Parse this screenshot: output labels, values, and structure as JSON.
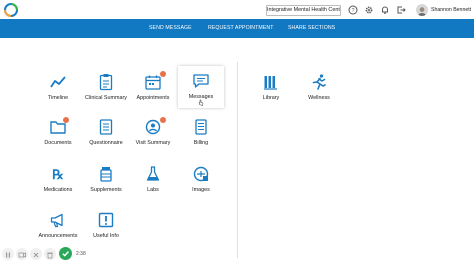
{
  "header": {
    "clinic_name": "Integrative Mental Health Center",
    "user_name": "Shannon Bennett"
  },
  "nav": {
    "send_message": "SEND MESSAGE",
    "request_appointment": "REQUEST APPOINTMENT",
    "share_sections": "SHARE SECTIONS"
  },
  "tiles": {
    "timeline": "Timeline",
    "clinical_summary": "Clinical Summary",
    "appointments": "Appointments",
    "messages": "Messages",
    "library": "Library",
    "wellness": "Wellness",
    "documents": "Documents",
    "questionnaire": "Questionnaire",
    "visit_summary": "Visit Summary",
    "billing": "Billing",
    "medications": "Medications",
    "supplements": "Supplements",
    "labs": "Labs",
    "images": "Images",
    "announcements": "Announcements",
    "useful_info": "Useful Info"
  },
  "player": {
    "time": "2:38"
  },
  "colors": {
    "brand_blue": "#1178c2",
    "icon_blue": "#1a7cc4",
    "badge": "#e8704a",
    "record_green": "#2aa85a"
  }
}
